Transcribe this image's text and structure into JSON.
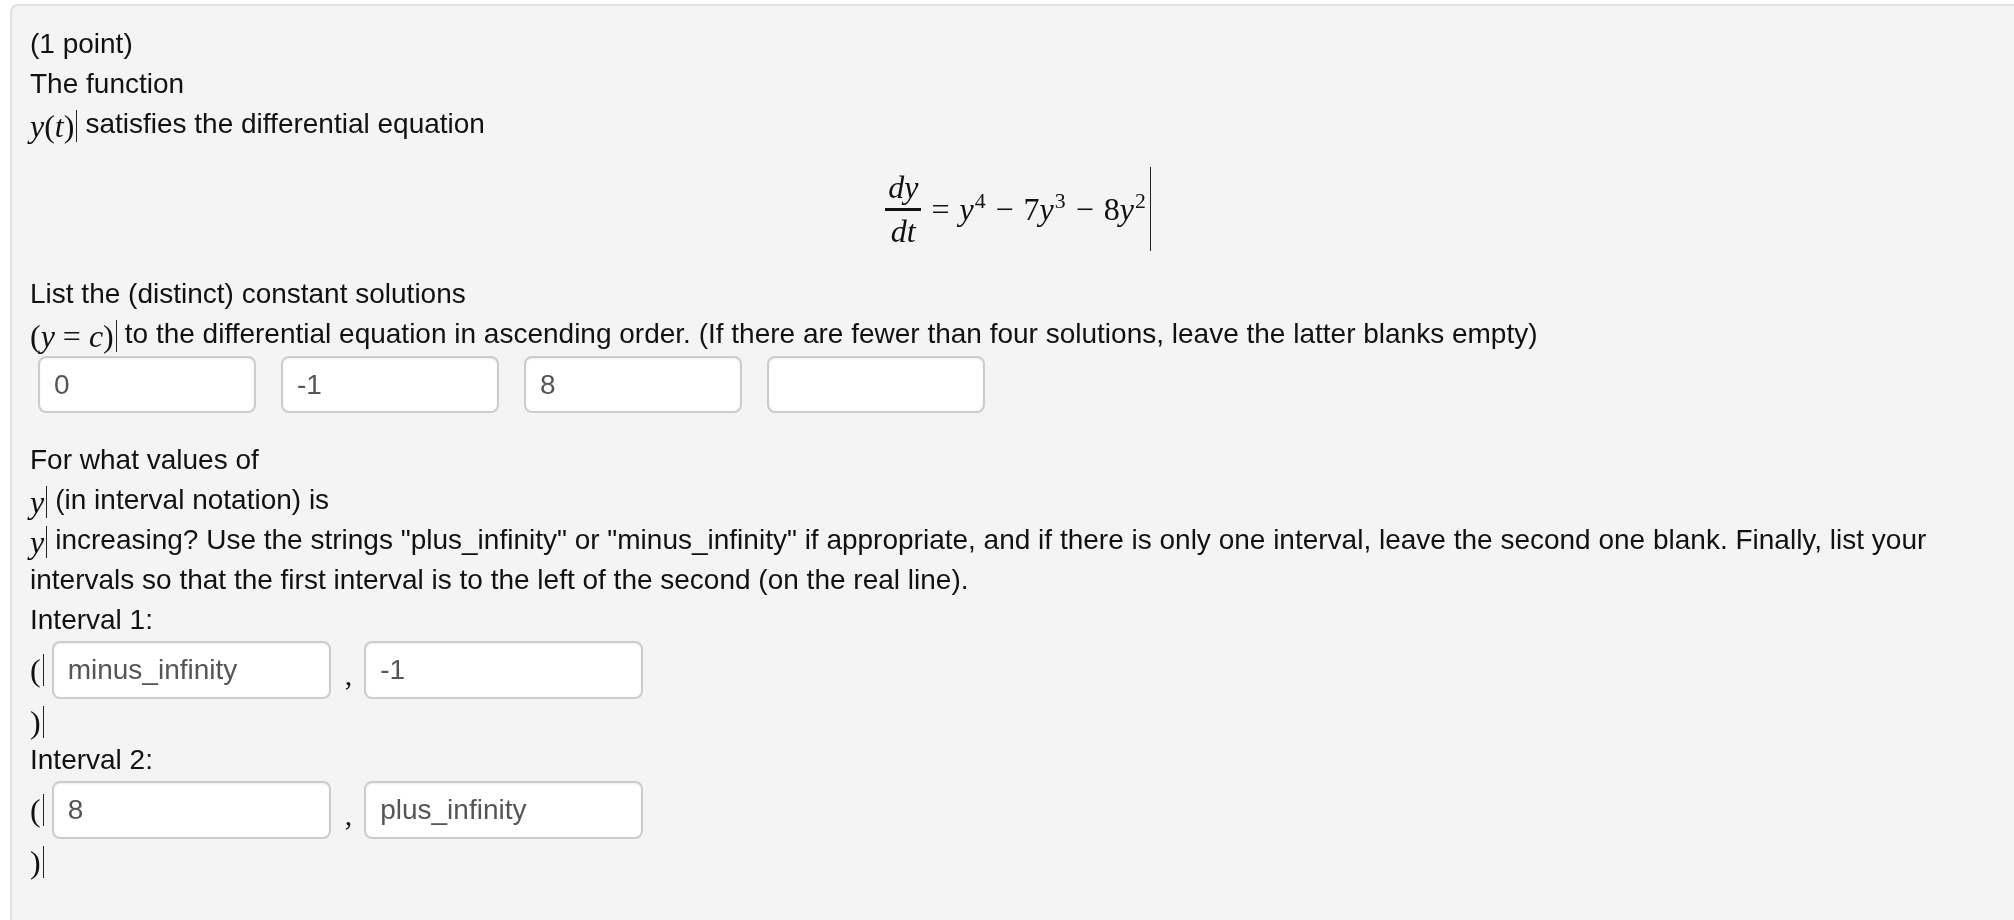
{
  "problem": {
    "body": [
      {
        "kind": "line",
        "parts": [
          {
            "kind": "text",
            "text": "(1 point)"
          }
        ]
      },
      {
        "kind": "line",
        "parts": [
          {
            "kind": "text",
            "text": "The function"
          }
        ]
      },
      {
        "kind": "line",
        "parts": [
          {
            "kind": "math",
            "text": "*y*(*t*)"
          },
          {
            "kind": "text",
            "text": "satisfies the differential equation"
          }
        ]
      },
      {
        "kind": "equation",
        "numerator": "dy",
        "denominator": "dt",
        "terms": [
          {
            "op": "=",
            "variable": "y",
            "power": "4"
          },
          {
            "op": "−",
            "coefficient": "7",
            "variable": "y",
            "power": "3"
          },
          {
            "op": "−",
            "coefficient": "8",
            "variable": "y",
            "power": "2"
          }
        ]
      },
      {
        "kind": "line",
        "parts": [
          {
            "kind": "text",
            "text": "List the (distinct) constant solutions"
          }
        ]
      },
      {
        "kind": "line",
        "parts": [
          {
            "kind": "math",
            "text": "(*y* = *c*)"
          },
          {
            "kind": "text",
            "text": "to the differential equation in ascending order. (If there are fewer than four solutions, leave the latter blanks empty)"
          }
        ]
      },
      {
        "kind": "answer_row",
        "parts": [
          {
            "kind": "field",
            "value": "0"
          },
          {
            "kind": "field",
            "value": "-1"
          },
          {
            "kind": "field",
            "value": "8"
          },
          {
            "kind": "field"
          }
        ]
      },
      {
        "kind": "line",
        "parts": [
          {
            "kind": "text",
            "text": "For what values of"
          }
        ]
      },
      {
        "kind": "line",
        "parts": [
          {
            "kind": "math",
            "text": "*y*"
          },
          {
            "kind": "text",
            "text": "(in interval notation) is"
          }
        ]
      },
      {
        "kind": "line",
        "parts": [
          {
            "kind": "math",
            "text": "*y*"
          },
          {
            "kind": "text",
            "text": "increasing? Use the strings \"plus_infinity\" or \"minus_infinity\" if appropriate, and if there is only one interval, leave the second one blank. Finally, list your intervals so that the first interval is to the left of the second (on the real line)."
          }
        ]
      },
      {
        "kind": "line",
        "parts": [
          {
            "kind": "text",
            "text": "Interval 1:"
          }
        ]
      },
      {
        "kind": "input_line",
        "parts": [
          {
            "kind": "math",
            "text": "("
          },
          {
            "kind": "field",
            "value": "minus_infinity"
          },
          {
            "kind": "punct",
            "text": ","
          },
          {
            "kind": "field",
            "value": "-1"
          }
        ]
      },
      {
        "kind": "line",
        "parts": [
          {
            "kind": "math",
            "text": ")"
          }
        ]
      },
      {
        "kind": "line",
        "parts": [
          {
            "kind": "text",
            "text": "Interval 2:"
          }
        ]
      },
      {
        "kind": "input_line",
        "parts": [
          {
            "kind": "math",
            "text": "("
          },
          {
            "kind": "field",
            "value": "8"
          },
          {
            "kind": "punct",
            "text": ","
          },
          {
            "kind": "field",
            "value": "plus_infinity"
          }
        ]
      },
      {
        "kind": "line",
        "parts": [
          {
            "kind": "math",
            "text": ")"
          }
        ]
      }
    ]
  }
}
